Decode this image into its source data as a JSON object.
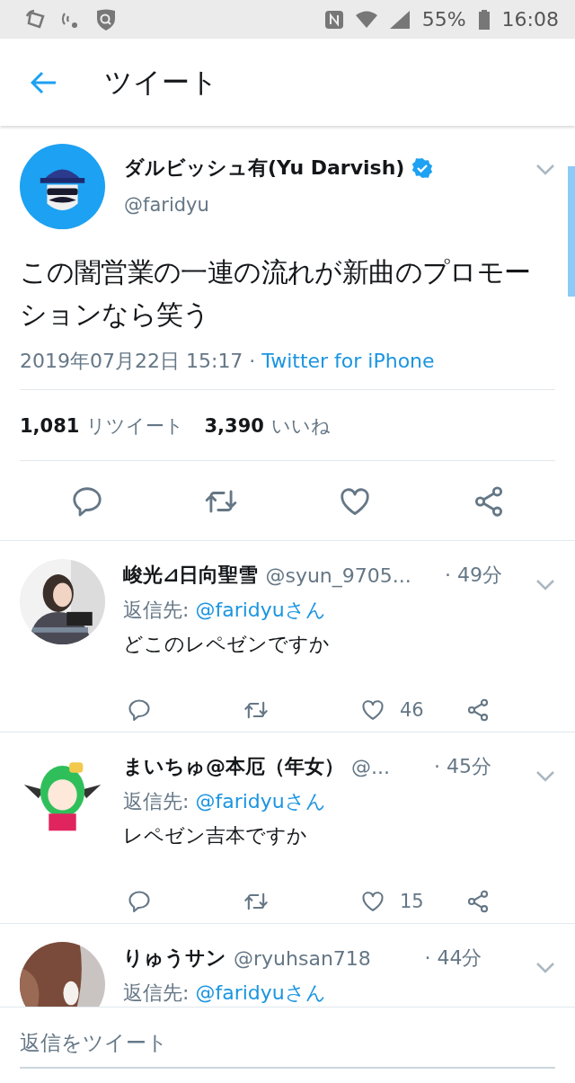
{
  "status_bar": {
    "battery": "55%",
    "time": "16:08"
  },
  "header": {
    "title": "ツイート"
  },
  "tweet": {
    "name": "ダルビッシュ有(Yu Darvish)",
    "verified": true,
    "handle": "@faridyu",
    "text": "この闇営業の一連の流れが新曲のプロモーションなら笑う",
    "timestamp": "2019年07月22日 15:17 ·",
    "source": "Twitter for iPhone",
    "stats": [
      {
        "count": "1,081",
        "label": "リツイート"
      },
      {
        "count": "3,390",
        "label": "いいね"
      }
    ]
  },
  "replies": [
    {
      "name": "峻光⊿日向聖雪",
      "handle": "@syun_9705...",
      "time": "· 49分",
      "reply_label": "返信先:",
      "reply_to": "@faridyuさん",
      "text": "どこのレペゼンですか",
      "likes": "46"
    },
    {
      "name": "まいちゅ@本厄（年女）",
      "handle": "@...",
      "time": "· 45分",
      "reply_label": "返信先:",
      "reply_to": "@faridyuさん",
      "text": "レペゼン吉本ですか",
      "likes": "15"
    },
    {
      "name": "りゅうサン",
      "handle": "@ryuhsan718",
      "time": "· 44分",
      "reply_label": "返信先:",
      "reply_to": "@faridyuさん"
    }
  ],
  "reply_bar": {
    "placeholder": "返信をツイート"
  }
}
